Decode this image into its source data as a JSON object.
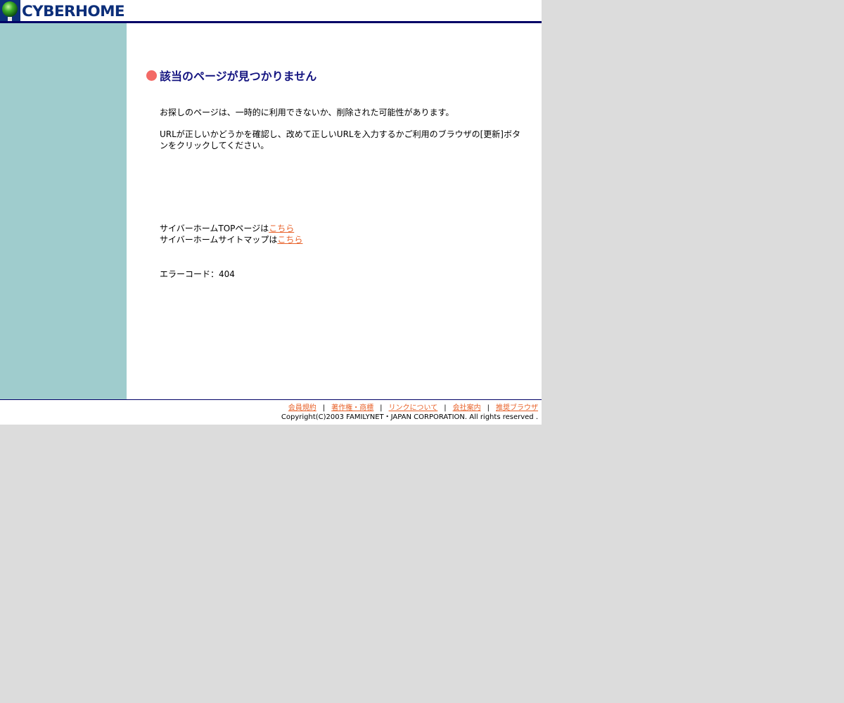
{
  "header": {
    "logo_text": "CYBERHOME"
  },
  "colors": {
    "header_border": "#000066",
    "sidebar_bg": "#9fcccd",
    "title_bullet": "#f36a66",
    "title_text": "#141480",
    "link": "#e8622a",
    "outer_bg": "#dcdcdc"
  },
  "main": {
    "title": "該当のページが見つかりません",
    "message_1": "お探しのページは、一時的に利用できないか、削除された可能性があります。",
    "message_2": "URLが正しいかどうかを確認し、改めて正しいURLを入力するかご利用のブラウザの[更新]ボタンをクリックしてください。",
    "top_page_prefix": "サイバーホームTOPページは",
    "top_page_link": "こちら",
    "sitemap_prefix": "サイバーホームサイトマップは",
    "sitemap_link": "こちら",
    "error_code": "エラーコード：404"
  },
  "footer": {
    "links": [
      "会員規約",
      "著作権・商標",
      "リンクについて",
      "会社案内",
      "推奨ブラウザ"
    ],
    "separator": "|",
    "copyright": "Copyright(C)2003 FAMILYNET・JAPAN CORPORATION. All rights reserved ."
  }
}
